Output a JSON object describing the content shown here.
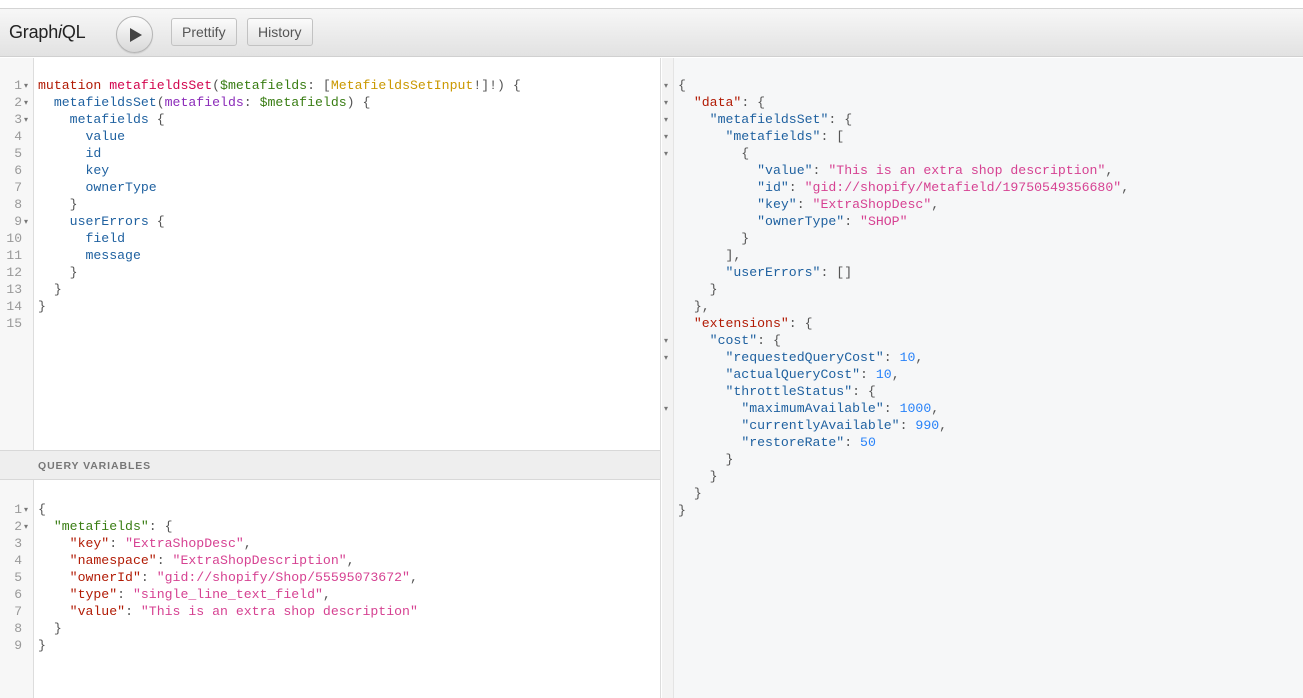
{
  "app": {
    "title_prefix": "Graph",
    "title_italic": "i",
    "title_suffix": "QL"
  },
  "toolbar": {
    "run_icon": "play-icon",
    "prettify_label": "Prettify",
    "history_label": "History"
  },
  "query_editor": {
    "line_numbers": [
      "1",
      "2",
      "3",
      "4",
      "5",
      "6",
      "7",
      "8",
      "9",
      "10",
      "11",
      "12",
      "13",
      "14",
      "15"
    ],
    "fold_markers": [
      "▾",
      "▾",
      "▾",
      "",
      "",
      "",
      "",
      "",
      "▾",
      "",
      "",
      "",
      "",
      "",
      ""
    ],
    "lines": [
      [
        [
          "k-kw",
          "mutation"
        ],
        [
          "k-punct",
          " "
        ],
        [
          "k-def",
          "metafieldsSet"
        ],
        [
          "k-punct",
          "("
        ],
        [
          "k-var",
          "$metafields"
        ],
        [
          "k-punct",
          ": ["
        ],
        [
          "k-type",
          "MetafieldsSetInput"
        ],
        [
          "k-punct",
          "!]!) {"
        ]
      ],
      [
        [
          "k-punct",
          "  "
        ],
        [
          "k-prop",
          "metafieldsSet"
        ],
        [
          "k-punct",
          "("
        ],
        [
          "k-attr",
          "metafields"
        ],
        [
          "k-punct",
          ": "
        ],
        [
          "k-var",
          "$metafields"
        ],
        [
          "k-punct",
          ") {"
        ]
      ],
      [
        [
          "k-punct",
          "    "
        ],
        [
          "k-prop",
          "metafields"
        ],
        [
          "k-punct",
          " {"
        ]
      ],
      [
        [
          "k-punct",
          "      "
        ],
        [
          "k-prop",
          "value"
        ]
      ],
      [
        [
          "k-punct",
          "      "
        ],
        [
          "k-prop",
          "id"
        ]
      ],
      [
        [
          "k-punct",
          "      "
        ],
        [
          "k-prop",
          "key"
        ]
      ],
      [
        [
          "k-punct",
          "      "
        ],
        [
          "k-prop",
          "ownerType"
        ]
      ],
      [
        [
          "k-punct",
          "    }"
        ]
      ],
      [
        [
          "k-punct",
          "    "
        ],
        [
          "k-prop",
          "userErrors"
        ],
        [
          "k-punct",
          " {"
        ]
      ],
      [
        [
          "k-punct",
          "      "
        ],
        [
          "k-prop",
          "field"
        ]
      ],
      [
        [
          "k-punct",
          "      "
        ],
        [
          "k-prop",
          "message"
        ]
      ],
      [
        [
          "k-punct",
          "    }"
        ]
      ],
      [
        [
          "k-punct",
          "  }"
        ]
      ],
      [
        [
          "k-punct",
          "}"
        ]
      ],
      [
        [
          "k-punct",
          ""
        ]
      ]
    ]
  },
  "variables": {
    "header": "QUERY VARIABLES",
    "line_numbers": [
      "1",
      "2",
      "3",
      "4",
      "5",
      "6",
      "7",
      "8",
      "9"
    ],
    "fold_markers": [
      "▾",
      "▾",
      "",
      "",
      "",
      "",
      "",
      "",
      ""
    ],
    "lines": [
      [
        [
          "k-punct",
          "{"
        ]
      ],
      [
        [
          "k-punct",
          "  "
        ],
        [
          "k-vvar-key",
          "\"metafields\""
        ],
        [
          "k-punct",
          ": {"
        ]
      ],
      [
        [
          "k-punct",
          "    "
        ],
        [
          "k-vkey",
          "\"key\""
        ],
        [
          "k-punct",
          ": "
        ],
        [
          "k-str",
          "\"ExtraShopDesc\""
        ],
        [
          "k-punct",
          ","
        ]
      ],
      [
        [
          "k-punct",
          "    "
        ],
        [
          "k-vkey",
          "\"namespace\""
        ],
        [
          "k-punct",
          ": "
        ],
        [
          "k-str",
          "\"ExtraShopDescription\""
        ],
        [
          "k-punct",
          ","
        ]
      ],
      [
        [
          "k-punct",
          "    "
        ],
        [
          "k-vkey",
          "\"ownerId\""
        ],
        [
          "k-punct",
          ": "
        ],
        [
          "k-str",
          "\"gid://shopify/Shop/55595073672\""
        ],
        [
          "k-punct",
          ","
        ]
      ],
      [
        [
          "k-punct",
          "    "
        ],
        [
          "k-vkey",
          "\"type\""
        ],
        [
          "k-punct",
          ": "
        ],
        [
          "k-str",
          "\"single_line_text_field\""
        ],
        [
          "k-punct",
          ","
        ]
      ],
      [
        [
          "k-punct",
          "    "
        ],
        [
          "k-vkey",
          "\"value\""
        ],
        [
          "k-punct",
          ": "
        ],
        [
          "k-str",
          "\"This is an extra shop description\""
        ]
      ],
      [
        [
          "k-punct",
          "  }"
        ]
      ],
      [
        [
          "k-punct",
          "}"
        ]
      ]
    ]
  },
  "result": {
    "fold_markers": [
      "▾",
      "▾",
      "▾",
      "▾",
      "▾",
      "",
      "",
      "",
      "",
      "",
      "",
      "",
      "",
      "",
      "",
      "▾",
      "▾",
      "",
      "",
      "▾",
      "",
      "",
      "",
      "",
      "",
      "",
      ""
    ],
    "lines": [
      [
        [
          "k-punct",
          "{"
        ]
      ],
      [
        [
          "k-punct",
          "  "
        ],
        [
          "k-rkey",
          "\"data\""
        ],
        [
          "k-punct",
          ": {"
        ]
      ],
      [
        [
          "k-punct",
          "    "
        ],
        [
          "k-rkey2",
          "\"metafieldsSet\""
        ],
        [
          "k-punct",
          ": {"
        ]
      ],
      [
        [
          "k-punct",
          "      "
        ],
        [
          "k-rkey2",
          "\"metafields\""
        ],
        [
          "k-punct",
          ": ["
        ]
      ],
      [
        [
          "k-punct",
          "        {"
        ]
      ],
      [
        [
          "k-punct",
          "          "
        ],
        [
          "k-rkey2",
          "\"value\""
        ],
        [
          "k-punct",
          ": "
        ],
        [
          "k-str",
          "\"This is an extra shop description\""
        ],
        [
          "k-punct",
          ","
        ]
      ],
      [
        [
          "k-punct",
          "          "
        ],
        [
          "k-rkey2",
          "\"id\""
        ],
        [
          "k-punct",
          ": "
        ],
        [
          "k-str",
          "\"gid://shopify/Metafield/19750549356680\""
        ],
        [
          "k-punct",
          ","
        ]
      ],
      [
        [
          "k-punct",
          "          "
        ],
        [
          "k-rkey2",
          "\"key\""
        ],
        [
          "k-punct",
          ": "
        ],
        [
          "k-str",
          "\"ExtraShopDesc\""
        ],
        [
          "k-punct",
          ","
        ]
      ],
      [
        [
          "k-punct",
          "          "
        ],
        [
          "k-rkey2",
          "\"ownerType\""
        ],
        [
          "k-punct",
          ": "
        ],
        [
          "k-str",
          "\"SHOP\""
        ]
      ],
      [
        [
          "k-punct",
          "        }"
        ]
      ],
      [
        [
          "k-punct",
          "      ],"
        ]
      ],
      [
        [
          "k-punct",
          "      "
        ],
        [
          "k-rkey2",
          "\"userErrors\""
        ],
        [
          "k-punct",
          ": []"
        ]
      ],
      [
        [
          "k-punct",
          "    }"
        ]
      ],
      [
        [
          "k-punct",
          "  },"
        ]
      ],
      [
        [
          "k-punct",
          "  "
        ],
        [
          "k-rkey",
          "\"extensions\""
        ],
        [
          "k-punct",
          ": {"
        ]
      ],
      [
        [
          "k-punct",
          "    "
        ],
        [
          "k-rkey2",
          "\"cost\""
        ],
        [
          "k-punct",
          ": {"
        ]
      ],
      [
        [
          "k-punct",
          "      "
        ],
        [
          "k-rkey2",
          "\"requestedQueryCost\""
        ],
        [
          "k-punct",
          ": "
        ],
        [
          "k-num",
          "10"
        ],
        [
          "k-punct",
          ","
        ]
      ],
      [
        [
          "k-punct",
          "      "
        ],
        [
          "k-rkey2",
          "\"actualQueryCost\""
        ],
        [
          "k-punct",
          ": "
        ],
        [
          "k-num",
          "10"
        ],
        [
          "k-punct",
          ","
        ]
      ],
      [
        [
          "k-punct",
          "      "
        ],
        [
          "k-rkey2",
          "\"throttleStatus\""
        ],
        [
          "k-punct",
          ": {"
        ]
      ],
      [
        [
          "k-punct",
          "        "
        ],
        [
          "k-rkey2",
          "\"maximumAvailable\""
        ],
        [
          "k-punct",
          ": "
        ],
        [
          "k-num",
          "1000"
        ],
        [
          "k-punct",
          ","
        ]
      ],
      [
        [
          "k-punct",
          "        "
        ],
        [
          "k-rkey2",
          "\"currentlyAvailable\""
        ],
        [
          "k-punct",
          ": "
        ],
        [
          "k-num",
          "990"
        ],
        [
          "k-punct",
          ","
        ]
      ],
      [
        [
          "k-punct",
          "        "
        ],
        [
          "k-rkey2",
          "\"restoreRate\""
        ],
        [
          "k-punct",
          ": "
        ],
        [
          "k-num",
          "50"
        ]
      ],
      [
        [
          "k-punct",
          "      }"
        ]
      ],
      [
        [
          "k-punct",
          "    }"
        ]
      ],
      [
        [
          "k-punct",
          "  }"
        ]
      ],
      [
        [
          "k-punct",
          "}"
        ]
      ]
    ]
  },
  "colors": {
    "keyword": "#b11a04",
    "definition": "#d2054e",
    "variable": "#397d13",
    "type": "#ca9800",
    "property": "#1f61a0",
    "attribute": "#8b2bb9",
    "string": "#d64292",
    "number": "#2882f9"
  }
}
